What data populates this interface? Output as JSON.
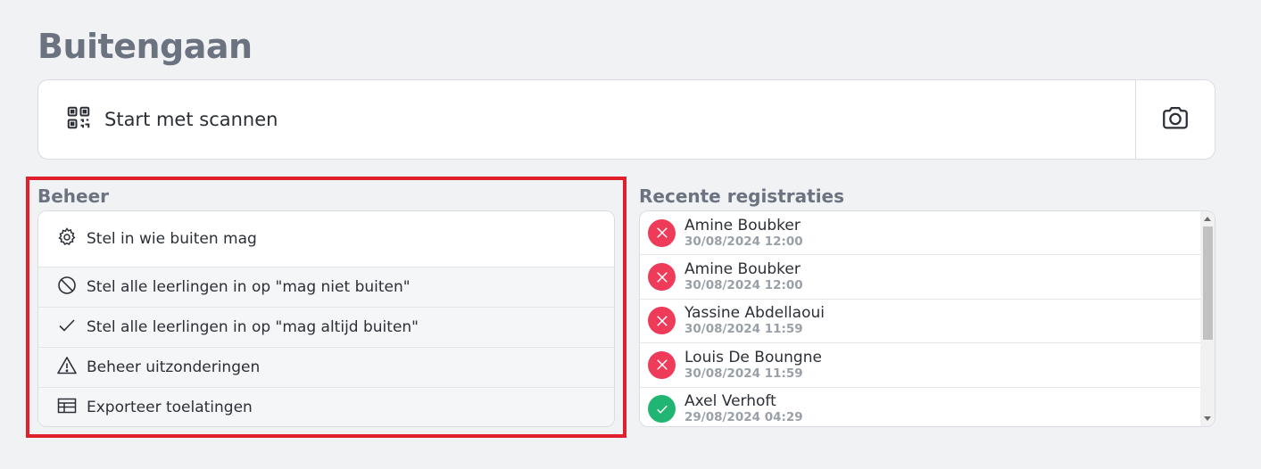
{
  "page": {
    "title": "Buitengaan"
  },
  "scan": {
    "label": "Start met scannen",
    "icon": "qr-code-icon",
    "camera_icon": "camera-icon"
  },
  "beheer": {
    "title": "Beheer",
    "items": [
      {
        "label": "Stel in wie buiten mag",
        "icon": "gear-icon"
      },
      {
        "label": "Stel alle leerlingen in op \"mag niet buiten\"",
        "icon": "ban-icon"
      },
      {
        "label": "Stel alle leerlingen in op \"mag altijd buiten\"",
        "icon": "check-icon"
      },
      {
        "label": "Beheer uitzonderingen",
        "icon": "warning-icon"
      },
      {
        "label": "Exporteer toelatingen",
        "icon": "table-icon"
      }
    ]
  },
  "recent": {
    "title": "Recente registraties",
    "rows": [
      {
        "name": "Amine Boubker",
        "time": "30/08/2024 12:00",
        "status": "denied"
      },
      {
        "name": "Amine Boubker",
        "time": "30/08/2024 12:00",
        "status": "denied"
      },
      {
        "name": "Yassine Abdellaoui",
        "time": "30/08/2024 11:59",
        "status": "denied"
      },
      {
        "name": "Louis De Boungne",
        "time": "30/08/2024 11:59",
        "status": "denied"
      },
      {
        "name": "Axel Verhoft",
        "time": "29/08/2024 04:29",
        "status": "allowed"
      }
    ]
  },
  "colors": {
    "denied": "#ef3b5a",
    "allowed": "#21b573",
    "highlight": "#e0202c"
  }
}
